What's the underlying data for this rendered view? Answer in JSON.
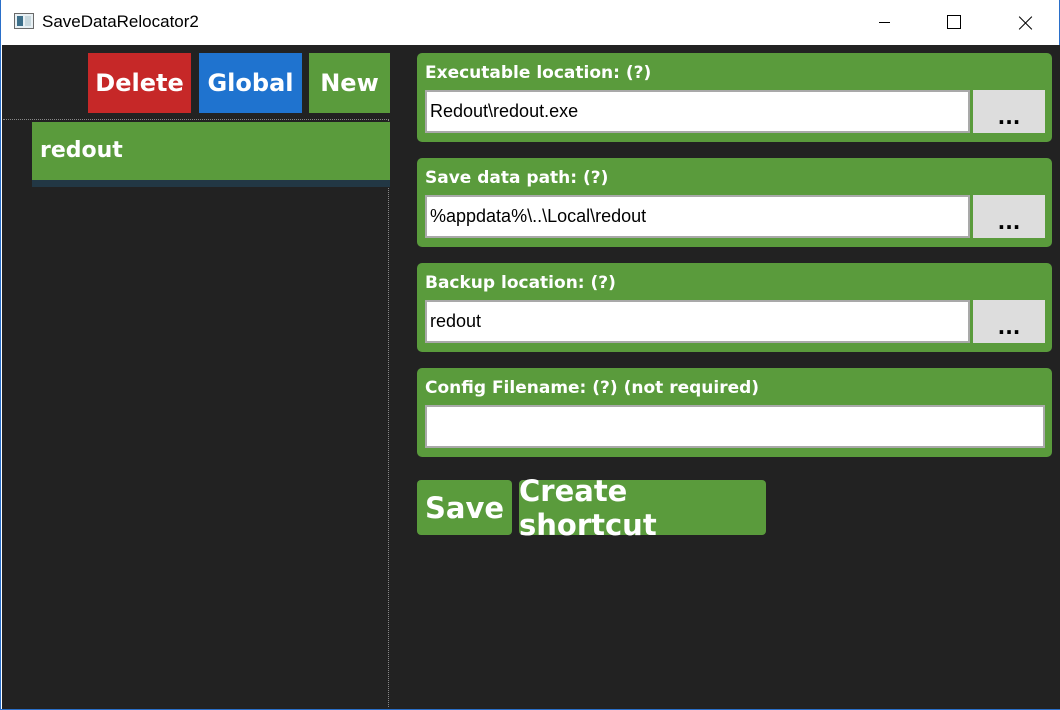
{
  "window": {
    "title": "SaveDataRelocator2",
    "icon": "app-window-icon"
  },
  "toolbar": {
    "delete_label": "Delete",
    "global_label": "Global",
    "new_label": "New"
  },
  "games": {
    "items": [
      {
        "label": "redout",
        "selected": true
      }
    ]
  },
  "fields": {
    "executable": {
      "label": "Executable location: (?)",
      "value": "Redout\\redout.exe",
      "browse_label": "..."
    },
    "save_data": {
      "label": "Save data path: (?)",
      "value": "%appdata%\\..\\Local\\redout",
      "browse_label": "..."
    },
    "backup": {
      "label": "Backup location: (?)",
      "value": "redout",
      "browse_label": "..."
    },
    "config": {
      "label": "Config Filename: (?) (not required)",
      "value": ""
    }
  },
  "actions": {
    "save_label": "Save",
    "shortcut_label": "Create shortcut"
  },
  "colors": {
    "background": "#222222",
    "green": "#5a9b3c",
    "red": "#c62828",
    "blue": "#1f73cf"
  }
}
